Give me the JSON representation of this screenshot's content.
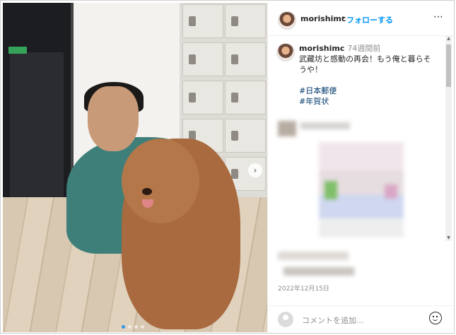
{
  "post": {
    "username": "morishimc",
    "separator": "•",
    "follow_label": "フォローする",
    "more_icon": "⋯"
  },
  "caption": {
    "username": "morishimc",
    "time_ago": "74週間前",
    "text": "武藏坊と感動の再会！もう俺と暮らそうや！",
    "hashtags": [
      "#日本郵便",
      "#年賀状"
    ]
  },
  "date": "2022年12月15日",
  "comment": {
    "placeholder": "コメントを追加..."
  },
  "carousel": {
    "next_icon": "›",
    "dot_count": 4,
    "active_index": 0
  },
  "colors": {
    "follow": "#0095f6",
    "hashtag": "#00376b",
    "sweater": "#3f7f7a",
    "dog": "#a86a3e"
  }
}
